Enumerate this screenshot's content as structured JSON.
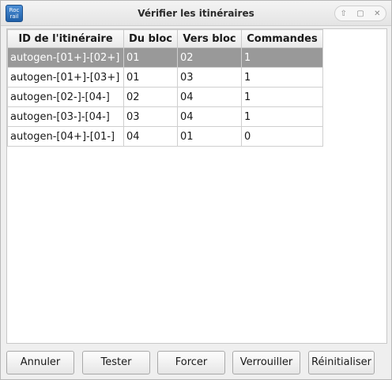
{
  "window": {
    "title": "Vérifier les itinéraires",
    "app_icon_text": "Roc rail"
  },
  "titlebar_buttons": [
    "⇧",
    "▢",
    "✕"
  ],
  "table": {
    "columns": [
      "ID de l'itinéraire",
      "Du bloc",
      "Vers bloc",
      "Commandes"
    ],
    "rows": [
      [
        "autogen-[01+]-[02+]",
        "01",
        "02",
        "1"
      ],
      [
        "autogen-[01+]-[03+]",
        "01",
        "03",
        "1"
      ],
      [
        "autogen-[02-]-[04-]",
        "02",
        "04",
        "1"
      ],
      [
        "autogen-[03-]-[04-]",
        "03",
        "04",
        "1"
      ],
      [
        "autogen-[04+]-[01-]",
        "04",
        "01",
        "0"
      ]
    ],
    "selected_row": 0
  },
  "buttons": {
    "cancel": "Annuler",
    "test": "Tester",
    "force": "Forcer",
    "lock": "Verrouiller",
    "reset": "Réinitialiser"
  },
  "colors": {
    "selection": "#999999",
    "selection_text": "#ffffff"
  }
}
